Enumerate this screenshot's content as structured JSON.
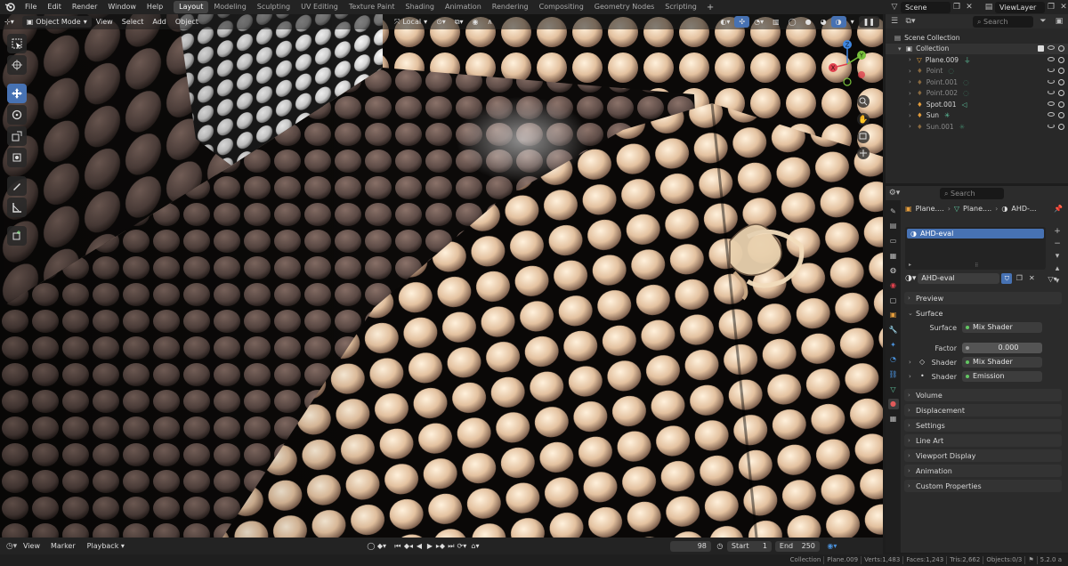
{
  "topbar": {
    "menus": [
      "File",
      "Edit",
      "Render",
      "Window",
      "Help"
    ],
    "workspaces": [
      {
        "label": "Layout",
        "active": true
      },
      {
        "label": "Modeling",
        "active": false
      },
      {
        "label": "Sculpting",
        "active": false
      },
      {
        "label": "UV Editing",
        "active": false
      },
      {
        "label": "Texture Paint",
        "active": false
      },
      {
        "label": "Shading",
        "active": false
      },
      {
        "label": "Animation",
        "active": false
      },
      {
        "label": "Rendering",
        "active": false
      },
      {
        "label": "Compositing",
        "active": false
      },
      {
        "label": "Geometry Nodes",
        "active": false
      },
      {
        "label": "Scripting",
        "active": false
      }
    ],
    "add_tab": "+",
    "scene": "Scene",
    "view_layer": "ViewLayer"
  },
  "viewport": {
    "mode": "Object Mode",
    "menus": [
      "View",
      "Select",
      "Add",
      "Object"
    ],
    "orientation": "Local",
    "gizmo_axes": {
      "x": "X",
      "y": "Y",
      "z": "Z"
    }
  },
  "outliner": {
    "search_placeholder": "Search",
    "root": "Scene Collection",
    "collection": "Collection",
    "items": [
      {
        "label": "Plane.009",
        "type": "mesh",
        "dim": false,
        "visible": true
      },
      {
        "label": "Point",
        "type": "light",
        "dim": true,
        "visible": false
      },
      {
        "label": "Point.001",
        "type": "light",
        "dim": true,
        "visible": false
      },
      {
        "label": "Point.002",
        "type": "light",
        "dim": true,
        "visible": false
      },
      {
        "label": "Spot.001",
        "type": "light",
        "dim": false,
        "visible": true
      },
      {
        "label": "Sun",
        "type": "light",
        "dim": false,
        "visible": true
      },
      {
        "label": "Sun.001",
        "type": "light",
        "dim": true,
        "visible": false
      }
    ]
  },
  "properties": {
    "search_placeholder": "Search",
    "breadcrumb": [
      "Plane....",
      "Plane....",
      "AHD-..."
    ],
    "material_slot": "AHD-eval",
    "material_name": "AHD-eval",
    "panels": {
      "preview": "Preview",
      "surface": "Surface",
      "volume": "Volume",
      "displacement": "Displacement",
      "settings": "Settings",
      "line_art": "Line Art",
      "viewport_display": "Viewport Display",
      "animation": "Animation",
      "custom_properties": "Custom Properties"
    },
    "surface": {
      "surface_label": "Surface",
      "surface_value": "Mix Shader",
      "factor_label": "Factor",
      "factor_value": "0.000",
      "shader1_label": "Shader",
      "shader1_value": "Mix Shader",
      "shader2_label": "Shader",
      "shader2_value": "Emission"
    }
  },
  "timeline": {
    "menus": [
      "View",
      "Marker"
    ],
    "playback": "Playback",
    "current_frame": "98",
    "start_label": "Start",
    "start_value": "1",
    "end_label": "End",
    "end_value": "250"
  },
  "statusbar": {
    "collection": "Collection",
    "object": "Plane.009",
    "verts": "Verts:1,483",
    "faces": "Faces:1,243",
    "tris": "Tris:2,662",
    "objects": "Objects:0/3",
    "version": "5.2.0 a"
  },
  "colors": {
    "accent": "#4772b3",
    "selection": "#4772b3",
    "active_tab": "#444444",
    "socket_green": "#63c763"
  }
}
